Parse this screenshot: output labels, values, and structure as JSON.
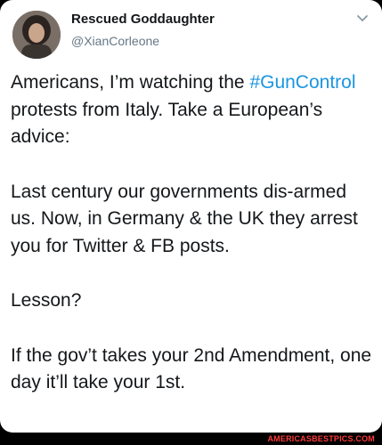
{
  "tweet": {
    "display_name": "Rescued Goddaughter",
    "handle": "@XianCorleone",
    "avatar_icon": "profile-avatar",
    "menu_icon": "chevron-down-icon",
    "paragraph1": {
      "before": "Americans, I’m watching the ",
      "hashtag": "#GunControl",
      "after": " protests from Italy. Take a European’s advice:"
    },
    "paragraph2": "Last century our governments dis-armed us. Now, in Germany & the UK they arrest you for Twitter & FB posts.",
    "paragraph3": "Lesson?",
    "paragraph4": "If the gov’t takes your 2nd Amendment, one day it’ll take your 1st."
  },
  "watermark": "AMERICASBESTPICS.COM",
  "colors": {
    "hashtag": "#1b95e0",
    "handle": "#657786",
    "watermark": "#ff3a3a"
  }
}
